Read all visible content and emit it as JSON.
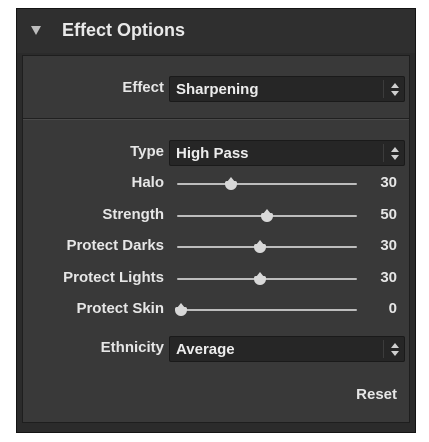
{
  "panel": {
    "title": "Effect Options",
    "effect": {
      "label": "Effect",
      "value": "Sharpening"
    },
    "type": {
      "label": "Type",
      "value": "High Pass"
    },
    "sliders": [
      {
        "label": "Halo",
        "value": "30",
        "fraction": 0.3
      },
      {
        "label": "Strength",
        "value": "50",
        "fraction": 0.5
      },
      {
        "label": "Protect Darks",
        "value": "30",
        "fraction": 0.46
      },
      {
        "label": "Protect Lights",
        "value": "30",
        "fraction": 0.46
      },
      {
        "label": "Protect Skin",
        "value": "0",
        "fraction": 0.0
      }
    ],
    "ethnicity": {
      "label": "Ethnicity",
      "value": "Average"
    },
    "reset_label": "Reset"
  },
  "colors": {
    "panel_bg": "#2b2b2b",
    "inner_bg": "#393939",
    "dropdown_bg": "#262626",
    "text": "#e6e6e6"
  },
  "icons": {
    "collapse": "triangle-down-icon",
    "dropdown": "updown-arrows-icon",
    "slider_thumb": "slider-thumb-icon"
  }
}
